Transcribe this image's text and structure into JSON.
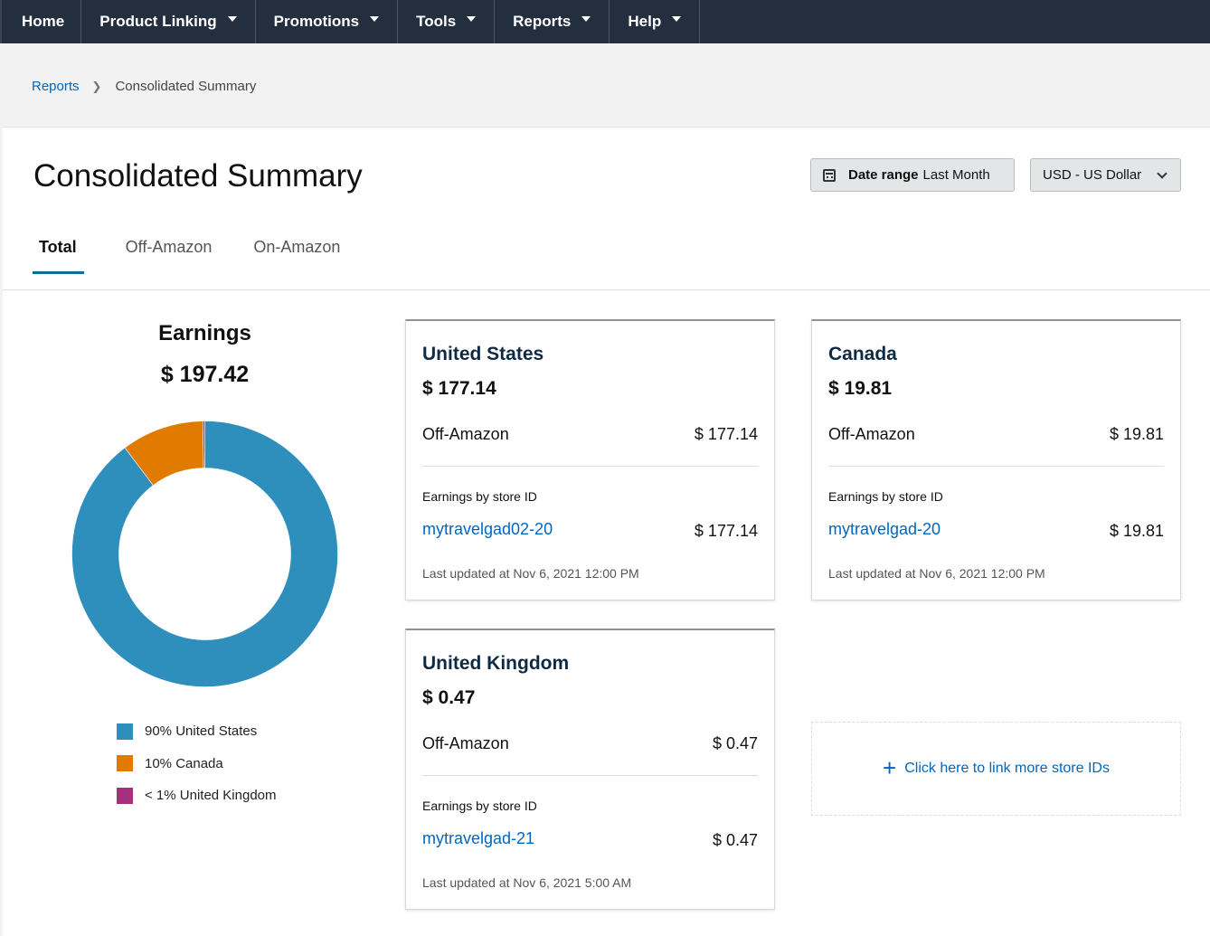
{
  "nav": {
    "items": [
      {
        "label": "Home",
        "dropdown": false
      },
      {
        "label": "Product Linking",
        "dropdown": true
      },
      {
        "label": "Promotions",
        "dropdown": true
      },
      {
        "label": "Tools",
        "dropdown": true
      },
      {
        "label": "Reports",
        "dropdown": true
      },
      {
        "label": "Help",
        "dropdown": true
      }
    ]
  },
  "breadcrumb": {
    "parent": "Reports",
    "current": "Consolidated Summary"
  },
  "page": {
    "title": "Consolidated Summary",
    "date_range_label": "Date range",
    "date_range_value": "Last Month",
    "currency": "USD - US Dollar"
  },
  "tabs": [
    {
      "label": "Total",
      "active": true
    },
    {
      "label": "Off-Amazon",
      "active": false
    },
    {
      "label": "On-Amazon",
      "active": false
    }
  ],
  "earnings": {
    "title": "Earnings",
    "total": "$ 197.42"
  },
  "chart_data": {
    "type": "pie",
    "donut": true,
    "categories": [
      "United States",
      "Canada",
      "United Kingdom"
    ],
    "values": [
      177.14,
      19.81,
      0.47
    ],
    "colors": [
      "#2e8fbd",
      "#e07b00",
      "#a3317e"
    ],
    "legend": [
      "90% United States",
      "10% Canada",
      "< 1% United Kingdom"
    ]
  },
  "cards": {
    "us": {
      "title": "United States",
      "amount": "$ 177.14",
      "channel_label": "Off-Amazon",
      "channel_amount": "$ 177.14",
      "store_heading": "Earnings by store ID",
      "store_id": "mytravelgad02-20",
      "store_amount": "$ 177.14",
      "updated": "Last updated at Nov 6, 2021 12:00 PM"
    },
    "ca": {
      "title": "Canada",
      "amount": "$ 19.81",
      "channel_label": "Off-Amazon",
      "channel_amount": "$ 19.81",
      "store_heading": "Earnings by store ID",
      "store_id": "mytravelgad-20",
      "store_amount": "$ 19.81",
      "updated": "Last updated at Nov 6, 2021 12:00 PM"
    },
    "uk": {
      "title": "United Kingdom",
      "amount": "$ 0.47",
      "channel_label": "Off-Amazon",
      "channel_amount": "$ 0.47",
      "store_heading": "Earnings by store ID",
      "store_id": "mytravelgad-21",
      "store_amount": "$ 0.47",
      "updated": "Last updated at Nov 6, 2021 5:00 AM"
    }
  },
  "link_more": {
    "label": "Click here to link more store IDs",
    "icon": "plus-icon"
  }
}
